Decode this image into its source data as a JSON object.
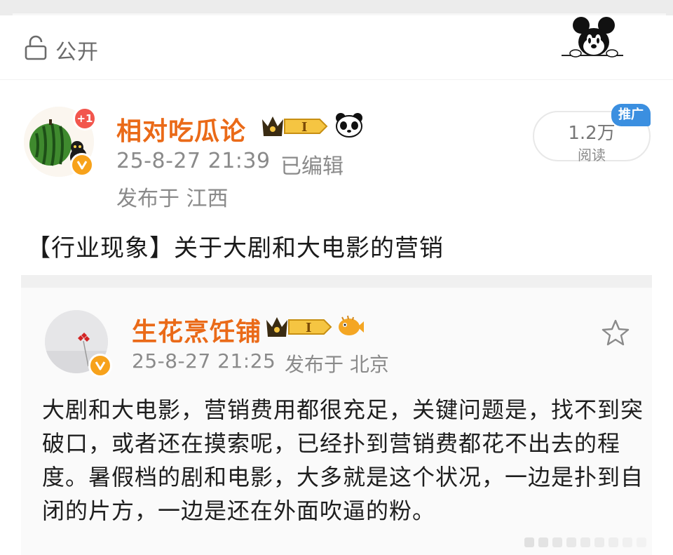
{
  "privacy": {
    "label": "公开",
    "icon": "unlock-icon"
  },
  "decoration": {
    "sticker": "mickey-sticker"
  },
  "post": {
    "author": {
      "name": "相对吃瓜论",
      "avatar": "watermelon-avatar",
      "notification_badge": "+1",
      "level": "I",
      "extra_icon": "panda-icon"
    },
    "timestamp": "25-8-27 21:39",
    "edited_label": "已编辑",
    "location": "发布于 江西",
    "reads": {
      "count": "1.2万",
      "label": "阅读"
    },
    "promo_label": "推广",
    "title": "【行业现象】关于大剧和大电影的营销"
  },
  "quoted": {
    "author": {
      "name": "生花烹饪铺",
      "level": "I",
      "extra_icon": "pufferfish-icon"
    },
    "timestamp": "25-8-27 21:25",
    "location": "发布于 北京",
    "body": "大剧和大电影，营销费用都很充足，关键问题是，找不到突破口，或者还在摸索呢，已经扑到营销费都花不出去的程度。暑假档的剧和电影，大多就是这个状况，一边是扑到自闭的片方，一边是还在外面吹逼的粉。"
  },
  "colors": {
    "username": "#ea6a18",
    "meta": "#8a8a8a",
    "promo": "#3b8fe0",
    "badge_red": "#f2564d",
    "verify_orange": "#f7a21b"
  }
}
